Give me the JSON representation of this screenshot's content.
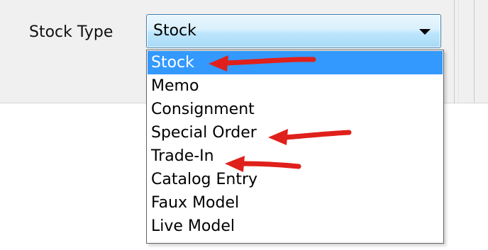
{
  "field": {
    "label": "Stock Type",
    "selected_value": "Stock"
  },
  "dropdown": {
    "options": [
      {
        "label": "Stock",
        "selected": true
      },
      {
        "label": "Memo",
        "selected": false
      },
      {
        "label": "Consignment",
        "selected": false
      },
      {
        "label": "Special Order",
        "selected": false
      },
      {
        "label": "Trade-In",
        "selected": false
      },
      {
        "label": "Catalog Entry",
        "selected": false
      },
      {
        "label": "Faux Model",
        "selected": false
      },
      {
        "label": "Live Model",
        "selected": false
      }
    ]
  },
  "annotations": {
    "arrow_color": "#e0201b",
    "arrow_targets": [
      "Stock",
      "Special Order",
      "Trade-In"
    ]
  },
  "colors": {
    "selection_highlight": "#3399ff",
    "combo_border": "#3c7fb1"
  },
  "icons": {
    "dropdown_toggle": "chevron-down-icon",
    "annotation": "red-arrow-icon"
  }
}
